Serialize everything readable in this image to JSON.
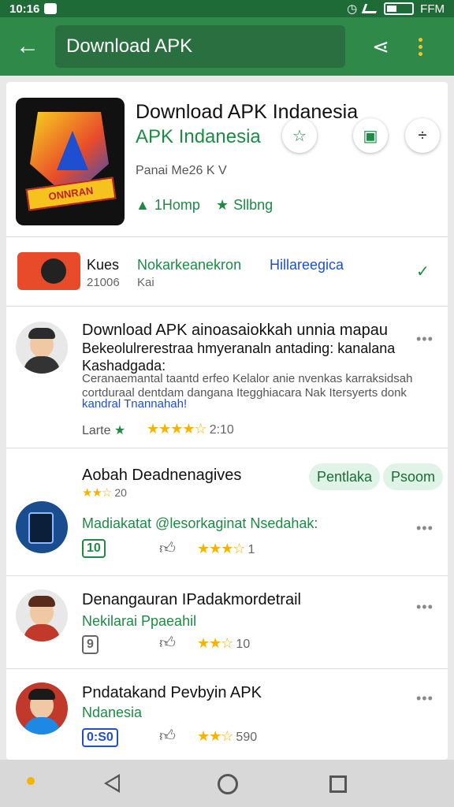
{
  "status_bar": {
    "time": "10:16",
    "right_label": "FFM"
  },
  "app_bar": {
    "search_text": "Download APK"
  },
  "app": {
    "title": "Download APK Indanesia",
    "developer": "APK Indanesia",
    "meta": "Panai Me26 K V",
    "stat_likes": "1Homp",
    "stat_star": "Sllbng"
  },
  "related": {
    "col1_title": "Kues",
    "col1_sub": "21006",
    "col2_title": "Nokarkeanekron",
    "col2_sub": "Kai",
    "col3_title": "Hillareegica"
  },
  "reviews": [
    {
      "title": "Download APK ainoasaiokkah unnia mapau",
      "line2": "Bekeolulrerestraa hmyeranaln antading: kanalana",
      "line3": "Kashadgada:",
      "body": "Ceranaemantal taantd erfeo Kelalor anie nvenkas karraksidsah cortduraal dentdam dangana Itegghiacara Nak Itersyerts donk",
      "link": "kandral Tnannahah!",
      "footer_label": "Larte",
      "rating_value": 4.5,
      "rating_text": "2:10"
    }
  ],
  "section": {
    "title": "Aobah Deadnenagives",
    "rating_text": "20",
    "chip1": "Pentlaka",
    "chip2": "Psoom"
  },
  "items": [
    {
      "title": "Madiakatat @lesorkaginat Nsedahak:",
      "badge": "10",
      "rating_text": "1"
    },
    {
      "title": "Denangauran IPadakmordetrail",
      "subtitle": "Nekilarai Ppaeahil",
      "badge": "9",
      "rating_text": "10"
    },
    {
      "title": "Pndatakand Pevbyin APK",
      "subtitle": "Ndanesia",
      "badge": "0:S0",
      "rating_text": "590"
    }
  ]
}
